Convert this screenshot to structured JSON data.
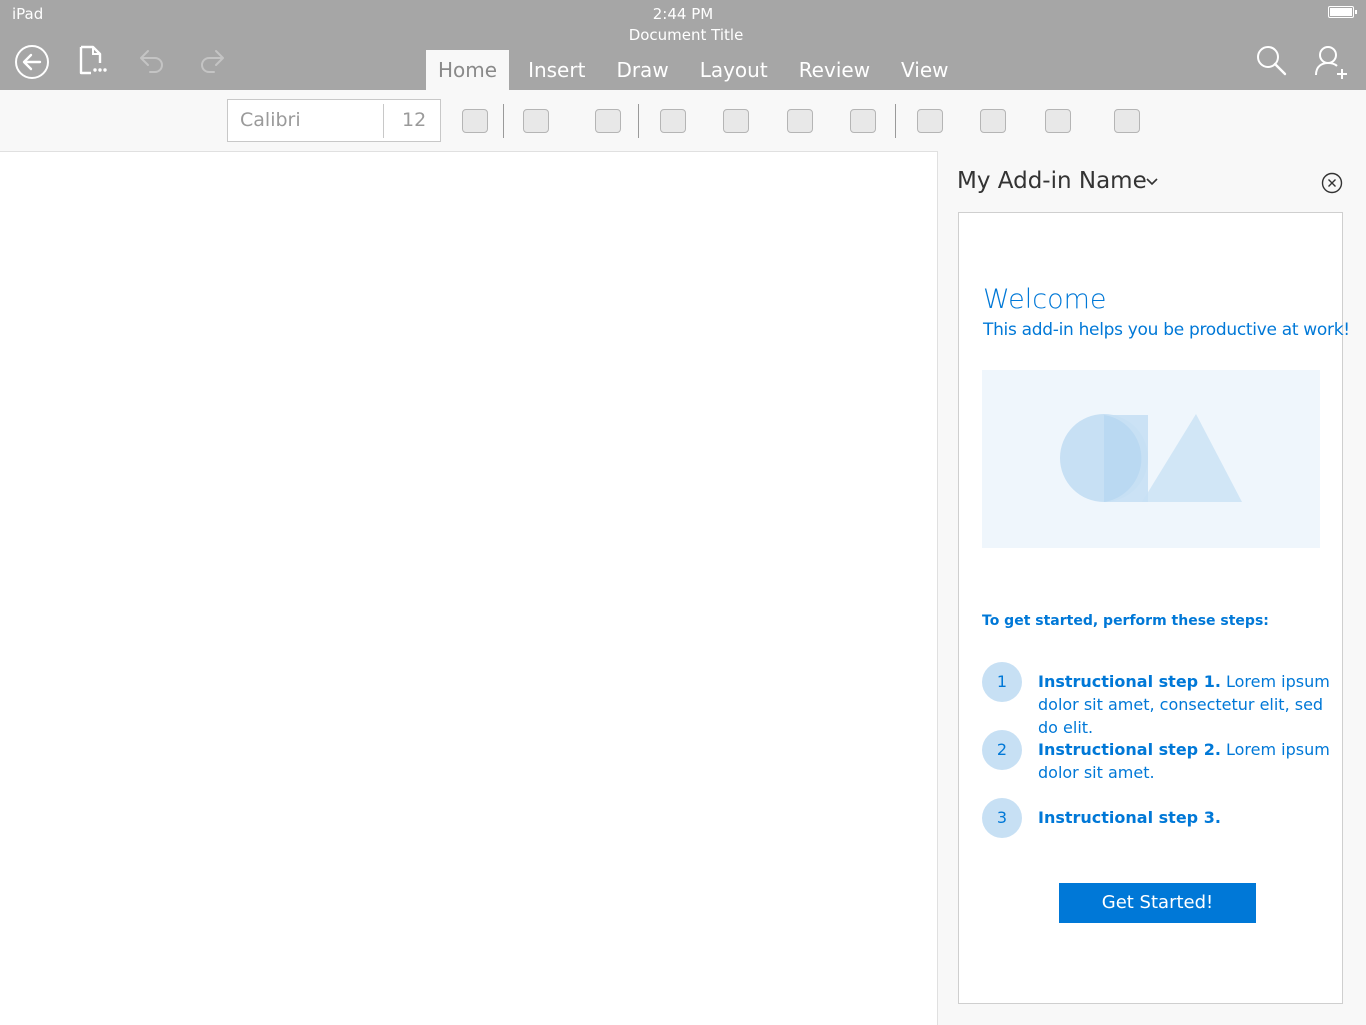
{
  "status_bar": {
    "device": "iPad",
    "time": "2:44 PM",
    "document_title": "Document Title"
  },
  "toolbar": {
    "back_icon": "back-arrow-circle-icon",
    "file_icon": "file-options-icon",
    "undo_icon": "undo-icon",
    "redo_icon": "redo-icon",
    "search_icon": "search-icon",
    "share_icon": "add-person-icon",
    "tabs": [
      {
        "label": "Home",
        "active": true
      },
      {
        "label": "Insert",
        "active": false
      },
      {
        "label": "Draw",
        "active": false
      },
      {
        "label": "Layout",
        "active": false
      },
      {
        "label": "Review",
        "active": false
      },
      {
        "label": "View",
        "active": false
      }
    ]
  },
  "ribbon": {
    "font_name": "Calibri",
    "font_size": "12"
  },
  "addin": {
    "name": "My Add-in Name",
    "welcome": "Welcome",
    "subtitle": "This add-in helps you be productive at work!",
    "steps_heading": "To get started, perform these steps:",
    "steps": [
      {
        "number": "1",
        "title": "Instructional step 1.",
        "body": " Lorem ipsum dolor sit amet, consectetur elit, sed do elit."
      },
      {
        "number": "2",
        "title": "Instructional step 2.",
        "body": " Lorem ipsum dolor sit amet."
      },
      {
        "number": "3",
        "title": "Instructional step 3.",
        "body": ""
      }
    ],
    "cta_label": "Get Started!"
  },
  "colors": {
    "accent": "#0078d7",
    "topbar": "#a6a6a6",
    "step_circle": "#c7e0f4",
    "hero_bg": "#eff6fc"
  }
}
